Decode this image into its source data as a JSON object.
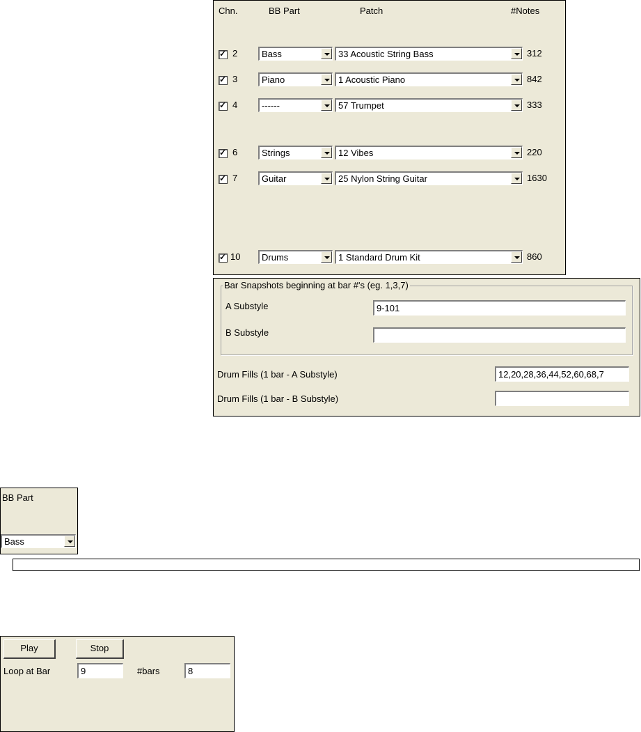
{
  "channels_panel": {
    "headers": {
      "chn": "Chn.",
      "bb_part": "BB Part",
      "patch": "Patch",
      "notes": "#Notes"
    },
    "rows": [
      {
        "checked": true,
        "chn": "2",
        "part": "Bass",
        "patch": "33 Acoustic String Bass",
        "notes": "312"
      },
      {
        "checked": true,
        "chn": "3",
        "part": "Piano",
        "patch": "1 Acoustic Piano",
        "notes": "842"
      },
      {
        "checked": true,
        "chn": "4",
        "part": "------",
        "patch": "57 Trumpet",
        "notes": "333"
      },
      {
        "checked": true,
        "chn": "6",
        "part": "Strings",
        "patch": "12 Vibes",
        "notes": "220"
      },
      {
        "checked": true,
        "chn": "7",
        "part": "Guitar",
        "patch": "25 Nylon String Guitar",
        "notes": "1630"
      },
      {
        "checked": true,
        "chn": "10",
        "part": "Drums",
        "patch": "1 Standard Drum Kit",
        "notes": "860"
      }
    ]
  },
  "snapshots_panel": {
    "group_title": "Bar Snapshots beginning at bar #'s (eg. 1,3,7)",
    "a_label": "A Substyle",
    "a_value": "9-101",
    "b_label": "B Substyle",
    "b_value": "",
    "fills_a_label": "Drum Fills (1 bar - A Substyle)",
    "fills_a_value": "12,20,28,36,44,52,60,68,7",
    "fills_b_label": "Drum Fills (1 bar - B Substyle)",
    "fills_b_value": ""
  },
  "bb_part_panel": {
    "label": "BB Part",
    "value": "Bass"
  },
  "playback_panel": {
    "play_label": "Play",
    "stop_label": "Stop",
    "loop_label": "Loop at Bar",
    "loop_value": "9",
    "bars_label": "#bars",
    "bars_value": "8"
  }
}
